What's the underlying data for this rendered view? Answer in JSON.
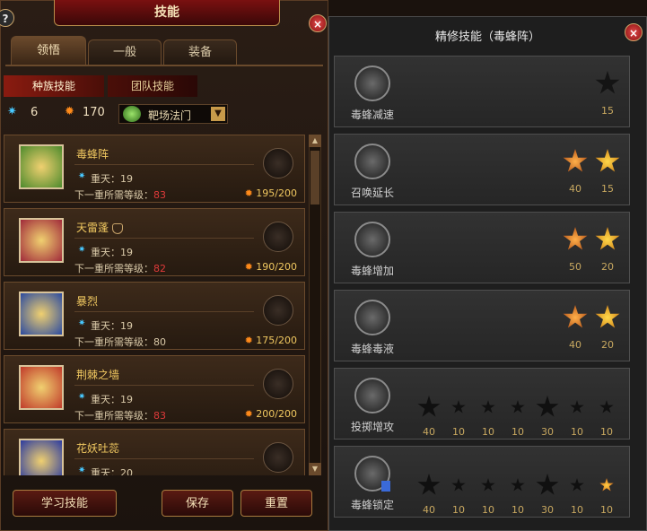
{
  "window_title": "技能",
  "help_label": "?",
  "close_label": "×",
  "tabs": [
    {
      "label": "领悟"
    },
    {
      "label": "一般"
    },
    {
      "label": "装备"
    }
  ],
  "subtabs": [
    {
      "label": "种族技能"
    },
    {
      "label": "团队技能"
    }
  ],
  "stats": {
    "points": "6",
    "flame": "170"
  },
  "skill_select": {
    "label": "靶场法门"
  },
  "skills": [
    {
      "name": "毒蜂阵",
      "layer": "重天：19",
      "next_prefix": "下一重所需等级：",
      "next_level": "83",
      "progress": "195/200",
      "thumb_color": "#4c8a2c"
    },
    {
      "name": "天雷蓬",
      "layer": "重天：19",
      "next_prefix": "下一重所需等级：",
      "next_level": "82",
      "progress": "190/200",
      "thumb_color": "#a02a3a"
    },
    {
      "name": "暴烈",
      "layer": "重天：19",
      "next_prefix": "下一重所需等级：",
      "next_level": "80",
      "progress": "175/200",
      "thumb_color": "#2a4aa0"
    },
    {
      "name": "荆棘之墙",
      "layer": "重天：19",
      "next_prefix": "下一重所需等级：",
      "next_level": "83",
      "progress": "200/200",
      "thumb_color": "#c03a2a"
    },
    {
      "name": "花妖吐蕊",
      "layer": "重天：20",
      "next_prefix": "",
      "next_level": "",
      "progress": "",
      "thumb_color": "#2a3aa0"
    }
  ],
  "buttons": {
    "learn": "学习技能",
    "save": "保存",
    "reset": "重置"
  },
  "refine": {
    "title": "精修技能（毒蜂阵）",
    "rows": [
      {
        "label": "毒蜂减速",
        "stars": [
          {
            "type": "dark",
            "value": "15"
          }
        ]
      },
      {
        "label": "召唤延长",
        "stars": [
          {
            "type": "orange",
            "value": "40"
          },
          {
            "type": "gold",
            "value": "15"
          }
        ]
      },
      {
        "label": "毒蜂增加",
        "stars": [
          {
            "type": "orange",
            "value": "50"
          },
          {
            "type": "gold",
            "value": "20"
          }
        ]
      },
      {
        "label": "毒蜂毒液",
        "stars": [
          {
            "type": "orange",
            "value": "40"
          },
          {
            "type": "gold",
            "value": "20"
          }
        ]
      },
      {
        "label": "投掷增攻",
        "small": [
          "40",
          "10",
          "10",
          "10",
          "30",
          "10",
          "10"
        ],
        "lit": []
      },
      {
        "label": "毒蜂锁定",
        "small": [
          "40",
          "10",
          "10",
          "10",
          "30",
          "10",
          "10"
        ],
        "lit": [
          6
        ]
      }
    ]
  }
}
